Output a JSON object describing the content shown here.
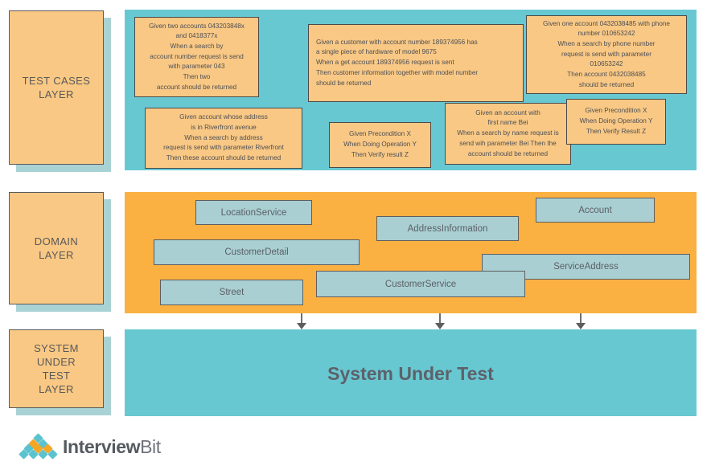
{
  "diagram": {
    "title": "Test Layers Architecture",
    "colors": {
      "teal_band": "#68c8d2",
      "orange_band": "#fbb042",
      "card_fill": "#f9c884",
      "domain_box_fill": "#a9cfd2",
      "text": "#5b5f66",
      "logo_teal": "#5bc3cf",
      "logo_orange": "#f5a623"
    }
  },
  "layers": [
    {
      "id": "test-cases",
      "label": "TEST CASES\nLAYER"
    },
    {
      "id": "domain",
      "label": "DOMAIN\nLAYER"
    },
    {
      "id": "system-under-test",
      "label": "SYSTEM\nUNDER\nTEST\nLAYER"
    }
  ],
  "test_cases": [
    {
      "id": "accounts-search",
      "text": "Given two accounts 043203848x\nand 0418377x\nWhen a search by\naccount number request is send\nwith parameter 043\nThen two\naccount should be returned"
    },
    {
      "id": "customer-hardware",
      "text": "Given a customer with account number 189374956 has\na single piece of hardware of model 9675\nWhen a get account 189374956 request is sent\nThen customer information together with model number\nshould be returned"
    },
    {
      "id": "account-phone",
      "text": "Given one account 0432038485 with phone\nnumber 010653242\nWhen a search by phone number\nrequest is send with parameter\n010653242\nThen account 0432038485\nshould be returned"
    },
    {
      "id": "address-riverfront",
      "text": "Given account whose address\nis in Riverfront avenue\nWhen a search by address\nrequest is send with parameter Riverfront\nThen these account should be returned"
    },
    {
      "id": "precondition-generic-middle",
      "text": "Given Precondition X\nWhen Doing Operation Y\nThen Verify result Z"
    },
    {
      "id": "account-first-name",
      "text": "Given an account with\nfirst name Bei\nWhen a search by name request is\nsend wih parameter Bei Then the\naccount should be returned"
    },
    {
      "id": "precondition-generic-right",
      "text": "Given Precondition X\nWhen Doing Operation Y\nThen Verify Result Z"
    }
  ],
  "domain_objects": [
    {
      "id": "location-service",
      "label": "LocationService"
    },
    {
      "id": "address-information",
      "label": "AddressInformation"
    },
    {
      "id": "account",
      "label": "Account"
    },
    {
      "id": "customer-detail",
      "label": "CustomerDetail"
    },
    {
      "id": "service-address",
      "label": "ServiceAddress"
    },
    {
      "id": "street",
      "label": "Street"
    },
    {
      "id": "customer-service",
      "label": "CustomerService"
    }
  ],
  "system_under_test": {
    "title": "System Under Test"
  },
  "logo": {
    "name_bold": "Interview",
    "name_light": "Bit"
  }
}
